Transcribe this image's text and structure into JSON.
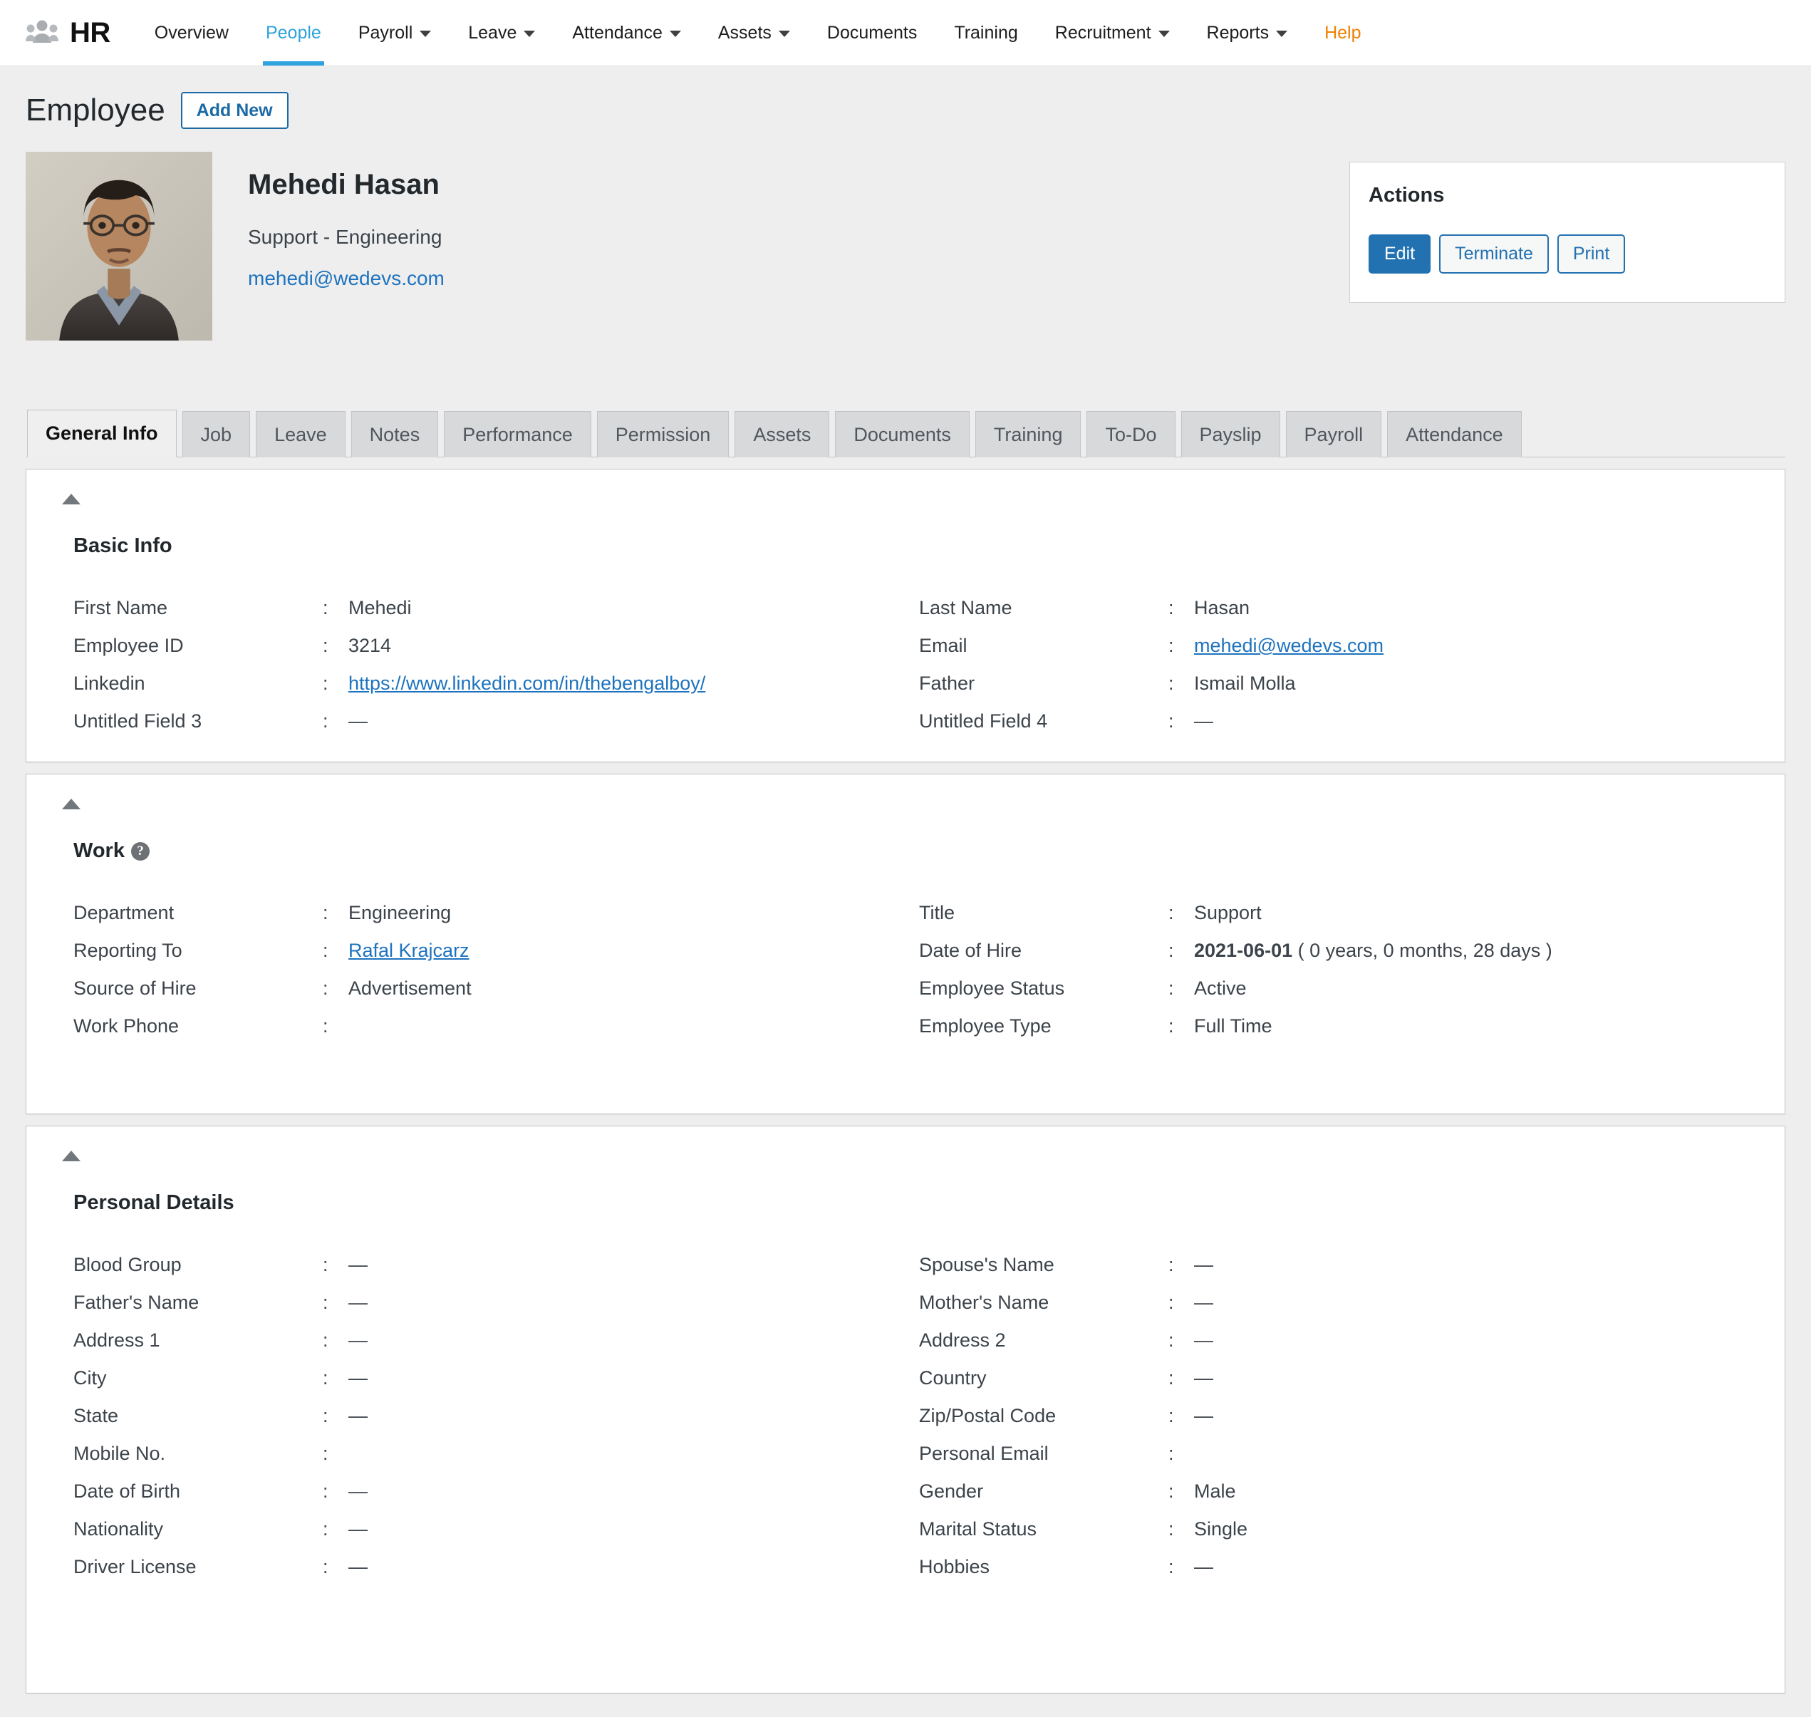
{
  "nav": {
    "brand": {
      "icon": "people-group-icon",
      "label": "HR"
    },
    "items": [
      {
        "label": "Overview",
        "caret": false,
        "active": false
      },
      {
        "label": "People",
        "caret": false,
        "active": true
      },
      {
        "label": "Payroll",
        "caret": true,
        "active": false
      },
      {
        "label": "Leave",
        "caret": true,
        "active": false
      },
      {
        "label": "Attendance",
        "caret": true,
        "active": false
      },
      {
        "label": "Assets",
        "caret": true,
        "active": false
      },
      {
        "label": "Documents",
        "caret": false,
        "active": false
      },
      {
        "label": "Training",
        "caret": false,
        "active": false
      },
      {
        "label": "Recruitment",
        "caret": true,
        "active": false
      },
      {
        "label": "Reports",
        "caret": true,
        "active": false
      },
      {
        "label": "Help",
        "caret": false,
        "active": false
      }
    ],
    "colors": {
      "active": "#2ea3dd",
      "help": "#f08000"
    }
  },
  "page": {
    "title": "Employee",
    "add_new_label": "Add New"
  },
  "employee": {
    "name": "Mehedi Hasan",
    "designation": "Support - Engineering",
    "email": "mehedi@wedevs.com",
    "avatar_alt": "employee-photo"
  },
  "actions": {
    "title": "Actions",
    "edit_label": "Edit",
    "terminate_label": "Terminate",
    "print_label": "Print"
  },
  "tabs": [
    {
      "label": "General Info",
      "active": true
    },
    {
      "label": "Job",
      "active": false
    },
    {
      "label": "Leave",
      "active": false
    },
    {
      "label": "Notes",
      "active": false
    },
    {
      "label": "Performance",
      "active": false
    },
    {
      "label": "Permission",
      "active": false
    },
    {
      "label": "Assets",
      "active": false
    },
    {
      "label": "Documents",
      "active": false
    },
    {
      "label": "Training",
      "active": false
    },
    {
      "label": "To-Do",
      "active": false
    },
    {
      "label": "Payslip",
      "active": false
    },
    {
      "label": "Payroll",
      "active": false
    },
    {
      "label": "Attendance",
      "active": false
    }
  ],
  "sections": {
    "basic_info": {
      "title": "Basic Info",
      "fields_left": [
        {
          "label": "First Name",
          "value": "Mehedi",
          "type": "text"
        },
        {
          "label": "Employee ID",
          "value": "3214",
          "type": "text"
        },
        {
          "label": "Linkedin",
          "value": "https://www.linkedin.com/in/thebengalboy/",
          "type": "link"
        },
        {
          "label": "Untitled Field 3",
          "value": "—",
          "type": "text"
        }
      ],
      "fields_right": [
        {
          "label": "Last Name",
          "value": "Hasan",
          "type": "text"
        },
        {
          "label": "Email",
          "value": "mehedi@wedevs.com",
          "type": "link"
        },
        {
          "label": "Father",
          "value": "Ismail Molla",
          "type": "text"
        },
        {
          "label": "Untitled Field 4",
          "value": "—",
          "type": "text"
        }
      ]
    },
    "work": {
      "title": "Work",
      "help_icon": "question-mark-icon",
      "fields_left": [
        {
          "label": "Department",
          "value": "Engineering",
          "type": "text"
        },
        {
          "label": "Reporting To",
          "value": "Rafal Krajcarz",
          "type": "link"
        },
        {
          "label": "Source of Hire",
          "value": "Advertisement",
          "type": "text"
        },
        {
          "label": "Work Phone",
          "value": "",
          "type": "text"
        }
      ],
      "fields_right": [
        {
          "label": "Title",
          "value": "Support",
          "type": "text"
        },
        {
          "label": "Date of Hire",
          "value": "2021-06-01",
          "suffix": " ( 0 years, 0 months, 28 days )",
          "type": "date"
        },
        {
          "label": "Employee Status",
          "value": "Active",
          "type": "text"
        },
        {
          "label": "Employee Type",
          "value": "Full Time",
          "type": "text"
        }
      ]
    },
    "personal_details": {
      "title": "Personal Details",
      "fields_left": [
        {
          "label": "Blood Group",
          "value": "—",
          "type": "text"
        },
        {
          "label": "Father's Name",
          "value": "—",
          "type": "text"
        },
        {
          "label": "Address 1",
          "value": "—",
          "type": "text"
        },
        {
          "label": "City",
          "value": "—",
          "type": "text"
        },
        {
          "label": "State",
          "value": "—",
          "type": "text"
        },
        {
          "label": "Mobile No.",
          "value": "",
          "type": "text"
        },
        {
          "label": "Date of Birth",
          "value": "—",
          "type": "text"
        },
        {
          "label": "Nationality",
          "value": "—",
          "type": "text"
        },
        {
          "label": "Driver License",
          "value": "—",
          "type": "text"
        }
      ],
      "fields_right": [
        {
          "label": "Spouse's Name",
          "value": "—",
          "type": "text"
        },
        {
          "label": "Mother's Name",
          "value": "—",
          "type": "text"
        },
        {
          "label": "Address 2",
          "value": "—",
          "type": "text"
        },
        {
          "label": "Country",
          "value": "—",
          "type": "text"
        },
        {
          "label": "Zip/Postal Code",
          "value": "—",
          "type": "text"
        },
        {
          "label": "Personal Email",
          "value": "",
          "type": "text"
        },
        {
          "label": "Gender",
          "value": "Male",
          "type": "text"
        },
        {
          "label": "Marital Status",
          "value": "Single",
          "type": "text"
        },
        {
          "label": "Hobbies",
          "value": "—",
          "type": "text"
        }
      ]
    }
  }
}
